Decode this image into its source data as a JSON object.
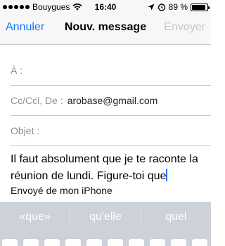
{
  "status_bar": {
    "carrier": "Bouygues",
    "time": "16:40",
    "battery_percent": "89 %",
    "battery_level": 0.89,
    "icons": [
      "signal-dots",
      "wifi-icon",
      "location-icon",
      "alarm-icon",
      "battery-icon"
    ]
  },
  "nav": {
    "cancel": "Annuler",
    "title": "Nouv. message",
    "send": "Envoyer"
  },
  "fields": {
    "to_label": "À :",
    "cc_label": "Cc/Cci, De :",
    "cc_value": "arobase@gmail.com",
    "subject_label": "Objet :"
  },
  "body": {
    "text": "Il faut absolument que je te raconte la réunion de lundi. Figure-toi que",
    "signature": "Envoyé de mon iPhone"
  },
  "suggestions": [
    "«que»",
    "qu'elle",
    "quel"
  ],
  "colors": {
    "accent": "#0a7aff",
    "disabled": "#c7c7cc",
    "keyboard": "#cdd1d8"
  }
}
